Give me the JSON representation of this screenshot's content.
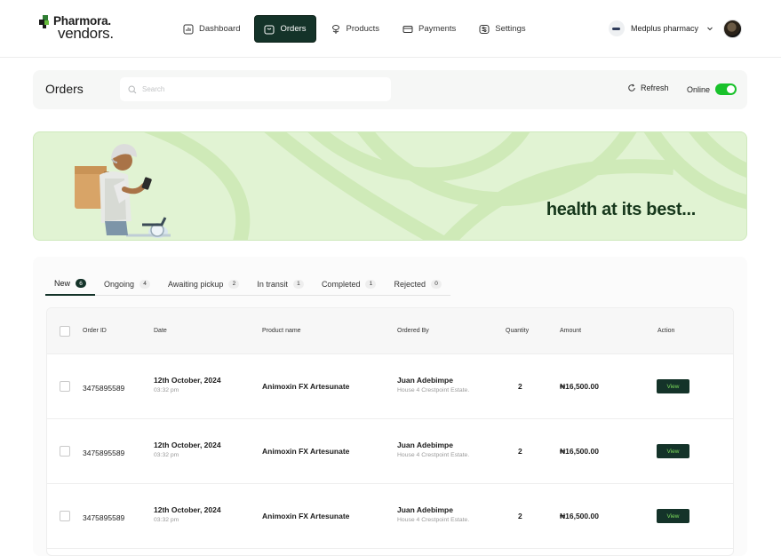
{
  "brand": {
    "line1": "Pharmora.",
    "line2": "vendors."
  },
  "nav": [
    {
      "label": "Dashboard",
      "icon": "chart-icon"
    },
    {
      "label": "Orders",
      "icon": "bag-icon",
      "active": true
    },
    {
      "label": "Products",
      "icon": "pill-icon"
    },
    {
      "label": "Payments",
      "icon": "card-icon"
    },
    {
      "label": "Settings",
      "icon": "gear-icon"
    }
  ],
  "account": {
    "name": "Medplus pharmacy"
  },
  "orders_header": {
    "title": "Orders",
    "search_placeholder": "Search",
    "refresh_label": "Refresh",
    "online_label": "Online",
    "online_on": true
  },
  "banner": {
    "text": "health at its best..."
  },
  "tabs": [
    {
      "label": "New",
      "count": "6"
    },
    {
      "label": "Ongoing",
      "count": "4"
    },
    {
      "label": "Awaiting pickup",
      "count": "2"
    },
    {
      "label": "In transit",
      "count": "1"
    },
    {
      "label": "Completed",
      "count": "1"
    },
    {
      "label": "Rejected",
      "count": "0"
    }
  ],
  "table": {
    "columns": [
      "Order ID",
      "Date",
      "Product name",
      "Ordered By",
      "Quantity",
      "Amount",
      "Action"
    ],
    "rows": [
      {
        "order_id": "3475895589",
        "date": "12th October, 2024",
        "time": "03:32 pm",
        "product": "Animoxin FX Artesunate",
        "customer": "Juan Adebimpe",
        "address": "House 4 Crestpoint Estate.",
        "quantity": "2",
        "amount": "₦16,500.00",
        "action": "View"
      },
      {
        "order_id": "3475895589",
        "date": "12th October, 2024",
        "time": "03:32 pm",
        "product": "Animoxin FX Artesunate",
        "customer": "Juan Adebimpe",
        "address": "House 4 Crestpoint Estate.",
        "quantity": "2",
        "amount": "₦16,500.00",
        "action": "View"
      },
      {
        "order_id": "3475895589",
        "date": "12th October, 2024",
        "time": "03:32 pm",
        "product": "Animoxin FX Artesunate",
        "customer": "Juan Adebimpe",
        "address": "House 4 Crestpoint Estate.",
        "quantity": "2",
        "amount": "₦16,500.00",
        "action": "View"
      }
    ]
  },
  "colors": {
    "primary": "#143329",
    "accent": "#7ddc5b",
    "banner_bg": "#e1f3d3",
    "toggle_on": "#19c22b"
  }
}
